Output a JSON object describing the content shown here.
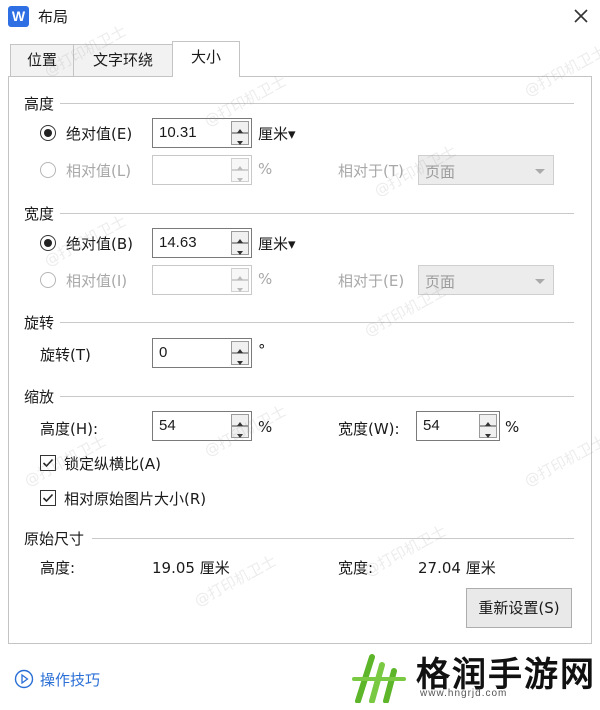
{
  "window": {
    "title": "布局",
    "app_icon_letter": "W"
  },
  "tabs": [
    {
      "label": "位置",
      "active": false
    },
    {
      "label": "文字环绕",
      "active": false
    },
    {
      "label": "大小",
      "active": true
    }
  ],
  "height_section": {
    "title": "高度",
    "absolute_label": "绝对值(E)",
    "absolute_value": "10.31",
    "absolute_unit": "厘米▾",
    "relative_label": "相对值(L)",
    "relative_value": "",
    "relative_unit": "%",
    "relative_to_label": "相对于(T)",
    "relative_to_value": "页面"
  },
  "width_section": {
    "title": "宽度",
    "absolute_label": "绝对值(B)",
    "absolute_value": "14.63",
    "absolute_unit": "厘米▾",
    "relative_label": "相对值(I)",
    "relative_value": "",
    "relative_unit": "%",
    "relative_to_label": "相对于(E)",
    "relative_to_value": "页面"
  },
  "rotation_section": {
    "title": "旋转",
    "label": "旋转(T)",
    "value": "0",
    "unit": "°"
  },
  "scale_section": {
    "title": "缩放",
    "height_label": "高度(H):",
    "height_value": "54",
    "height_unit": "%",
    "width_label": "宽度(W):",
    "width_value": "54",
    "width_unit": "%",
    "lock_aspect_label": "锁定纵横比(A)",
    "lock_aspect_checked": true,
    "relative_original_label": "相对原始图片大小(R)",
    "relative_original_checked": true
  },
  "original_size_section": {
    "title": "原始尺寸",
    "height_label": "高度:",
    "height_value": "19.05 厘米",
    "width_label": "宽度:",
    "width_value": "27.04 厘米"
  },
  "reset_button_label": "重新设置(S)",
  "footer": {
    "help_label": "操作技巧"
  },
  "watermark_text": "@打印机卫士",
  "brand": {
    "name": "格润手游网",
    "url": "www.hngrjd.com"
  },
  "colors": {
    "accent_blue": "#2f6fe4",
    "link_blue": "#2a6fd6",
    "brand_green": "#5db52a"
  }
}
